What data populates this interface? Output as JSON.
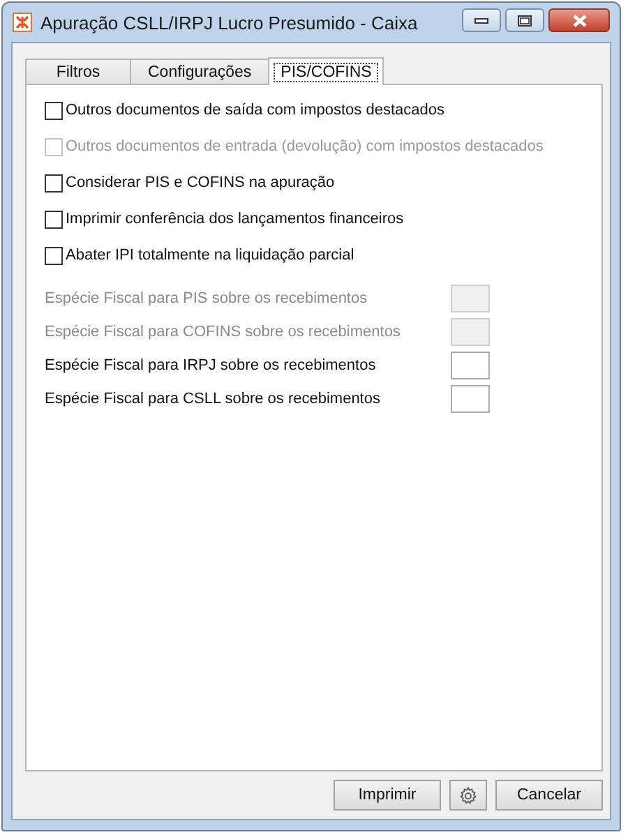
{
  "window": {
    "title": "Apuração CSLL/IRPJ Lucro Presumido - Caixa"
  },
  "tabs": [
    {
      "label": "Filtros",
      "selected": false
    },
    {
      "label": "Configurações",
      "selected": false
    },
    {
      "label": "PIS/COFINS",
      "selected": true
    }
  ],
  "options": [
    {
      "label": "Outros documentos de saída com impostos destacados",
      "checked": false,
      "disabled": false
    },
    {
      "label": "Outros documentos de entrada (devolução) com impostos destacados",
      "checked": false,
      "disabled": true
    },
    {
      "label": "Considerar PIS e COFINS na apuração",
      "checked": false,
      "disabled": false
    },
    {
      "label": "Imprimir conferência dos lançamentos financeiros",
      "checked": false,
      "disabled": false
    },
    {
      "label": "Abater IPI totalmente na liquidação parcial",
      "checked": false,
      "disabled": false
    }
  ],
  "fields": [
    {
      "label": "Espécie Fiscal para PIS sobre os recebimentos",
      "disabled": true
    },
    {
      "label": "Espécie Fiscal para COFINS sobre os recebimentos",
      "disabled": true
    },
    {
      "label": "Espécie Fiscal para IRPJ sobre os recebimentos",
      "disabled": false
    },
    {
      "label": "Espécie Fiscal para CSLL sobre os recebimentos",
      "disabled": false
    }
  ],
  "buttons": [
    {
      "kind": "text",
      "label": "Imprimir"
    },
    {
      "kind": "settings"
    },
    {
      "kind": "text",
      "label": "Cancelar"
    }
  ]
}
